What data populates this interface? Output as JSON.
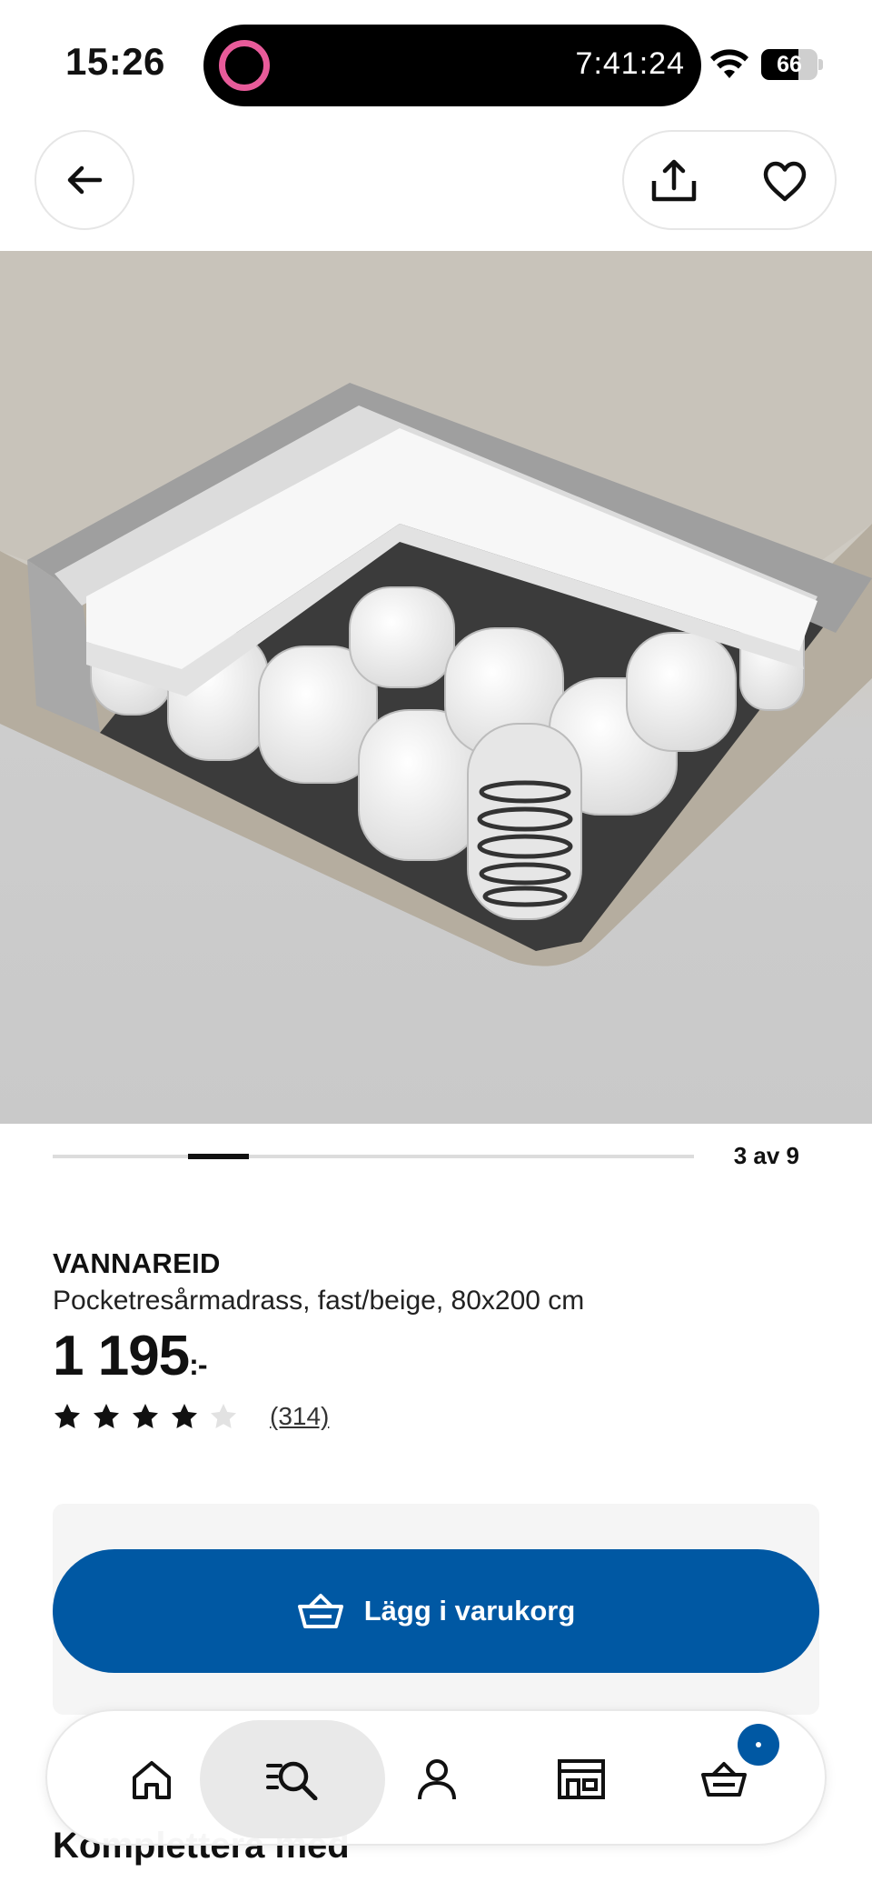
{
  "status_bar": {
    "time": "15:26",
    "timer": "7:41:24",
    "battery": "66",
    "battery_level": 0.66
  },
  "nav": {
    "back_icon": "arrow-left-icon",
    "share_icon": "share-icon",
    "favorite_icon": "heart-icon"
  },
  "carousel": {
    "counter": "3 av 9",
    "current": 3,
    "total": 9
  },
  "product": {
    "name": "VANNAREID",
    "description": "Pocketresårmadrass, fast/beige, 80x200 cm",
    "price": "1 195",
    "price_suffix": ":-",
    "rating": 4,
    "rating_max": 5,
    "review_count": "(314)"
  },
  "cart": {
    "button_label": "Lägg i varukorg",
    "button_color": "#0058a3"
  },
  "section": {
    "heading": "Komplettera med"
  },
  "tab_bar": {
    "tabs": [
      {
        "name": "home",
        "icon": "home-icon"
      },
      {
        "name": "search",
        "icon": "search-list-icon",
        "active": true
      },
      {
        "name": "profile",
        "icon": "person-icon"
      },
      {
        "name": "store",
        "icon": "store-icon"
      },
      {
        "name": "cart",
        "icon": "basket-icon"
      }
    ]
  }
}
